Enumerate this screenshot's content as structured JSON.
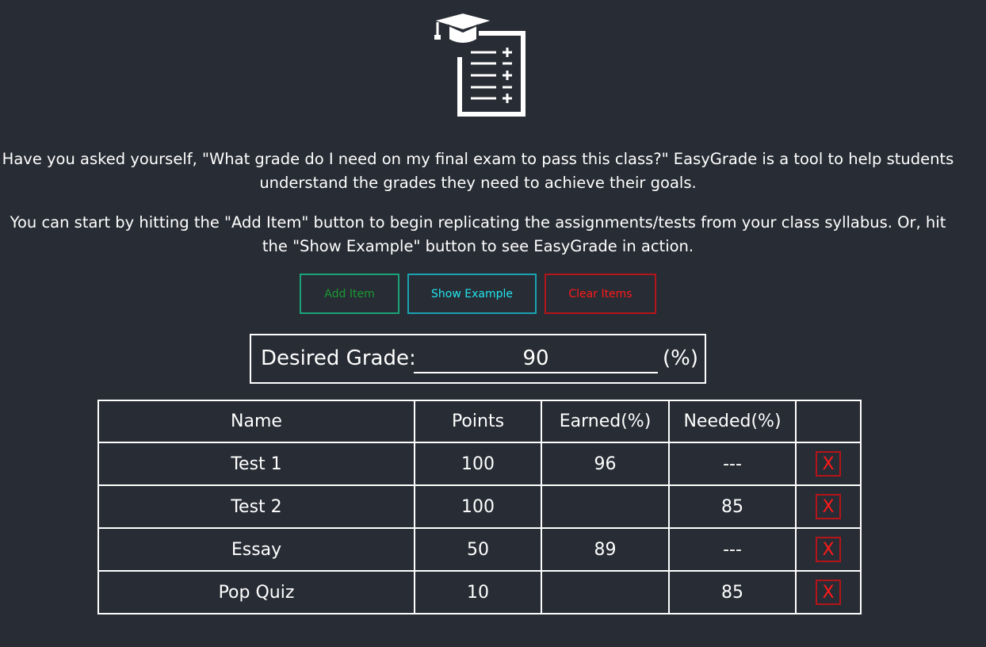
{
  "logo": {
    "icon": "graduation-cap-clipboard-icon"
  },
  "intro": {
    "paragraph1": "Have you asked yourself, \"What grade do I need on my final exam to pass this class?\" EasyGrade is a tool to help students understand the grades they need to achieve their goals.",
    "paragraph2": "You can start by hitting the \"Add Item\" button to begin replicating the assignments/tests from your class syllabus. Or, hit the \"Show Example\" button to see EasyGrade in action."
  },
  "buttons": {
    "add_item": "Add Item",
    "show_example": "Show Example",
    "clear_items": "Clear Items"
  },
  "desired_grade": {
    "label": "Desired Grade:",
    "value": "90",
    "unit": "(%)"
  },
  "table": {
    "headers": [
      "Name",
      "Points",
      "Earned(%)",
      "Needed(%)",
      ""
    ],
    "rows": [
      {
        "name": "Test 1",
        "points": "100",
        "earned": "96",
        "needed": "---",
        "delete": "X"
      },
      {
        "name": "Test 2",
        "points": "100",
        "earned": "",
        "needed": "85",
        "delete": "X"
      },
      {
        "name": "Essay",
        "points": "50",
        "earned": "89",
        "needed": "---",
        "delete": "X"
      },
      {
        "name": "Pop Quiz",
        "points": "10",
        "earned": "",
        "needed": "85",
        "delete": "X"
      }
    ]
  },
  "colors": {
    "background": "#282c34",
    "add_button": "#1a9a33",
    "example_button": "#23e6ef",
    "clear_button": "#ff1a1a"
  }
}
